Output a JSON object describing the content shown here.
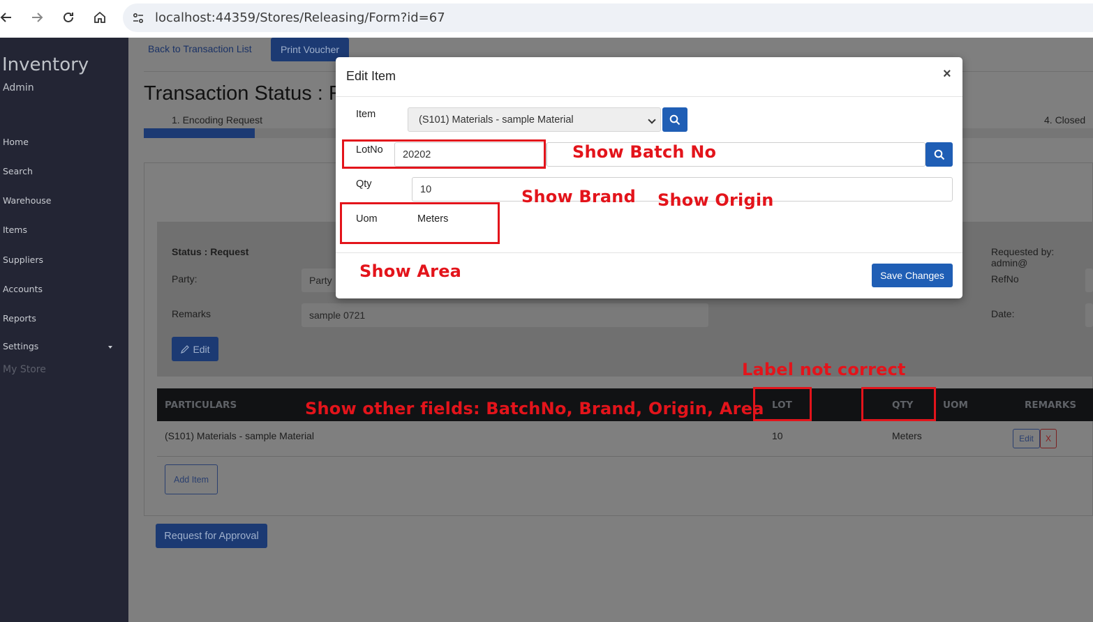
{
  "browser": {
    "url": "localhost:44359/Stores/Releasing/Form?id=67"
  },
  "sidebar": {
    "app_name": "Inventory",
    "user": "Admin",
    "items": [
      {
        "label": "Home"
      },
      {
        "label": "Search"
      },
      {
        "label": "Warehouse"
      },
      {
        "label": "Items"
      },
      {
        "label": "Suppliers"
      },
      {
        "label": "Accounts"
      },
      {
        "label": "Reports"
      },
      {
        "label": "Settings"
      },
      {
        "label": "My Store"
      }
    ]
  },
  "main": {
    "back_link": "Back to Transaction List",
    "print_button": "Print Voucher",
    "title": "Transaction Status : R",
    "steps": {
      "first": "1. Encoding Request",
      "last": "4. Closed"
    },
    "status_label": "Status : Request",
    "requested_by": "Requested by: admin@",
    "party_label": "Party:",
    "party_placeholder": "Party",
    "refno_label": "RefNo",
    "remarks_label": "Remarks",
    "remarks_value": "sample 0721",
    "date_label": "Date:",
    "edit_button": "Edit",
    "table": {
      "headers": [
        "PARTICULARS",
        "LOT",
        "QTY",
        "UOM",
        "REMARKS"
      ],
      "rows": [
        {
          "particulars": "(S101) Materials - sample Material",
          "lot": "10",
          "qty": "Meters",
          "edit": "Edit",
          "delete": "X"
        }
      ]
    },
    "add_item_button": "Add Item",
    "approval_button": "Request for Approval"
  },
  "modal": {
    "title": "Edit Item",
    "close": "×",
    "item_label": "Item",
    "item_value": "(S101) Materials - sample Material",
    "lotno_label": "LotNo",
    "lotno_value": "20202",
    "qty_label": "Qty",
    "qty_value": "10",
    "uom_label": "Uom",
    "uom_value": "Meters",
    "save_button": "Save Changes"
  },
  "annotations": {
    "batch": "Show Batch No",
    "brand": "Show Brand",
    "origin": "Show Origin",
    "area": "Show Area",
    "label": "Label not correct",
    "other": "Show other fields: BatchNo, Brand, Origin, Area"
  },
  "colors": {
    "sidebar_bg": "#232534",
    "primary": "#1f5eb5",
    "annotation": "#e3141b"
  }
}
